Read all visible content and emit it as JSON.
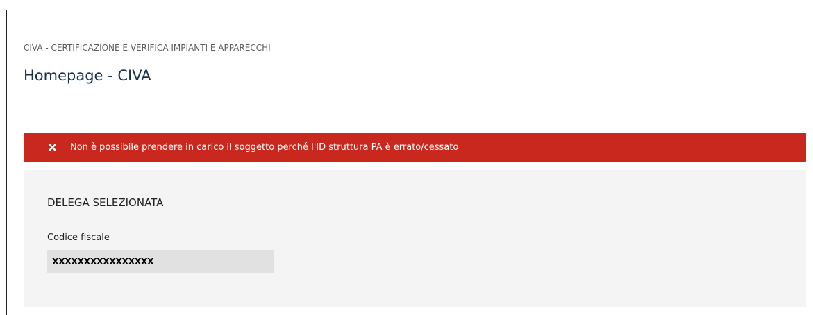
{
  "breadcrumb": "CIVA - CERTIFICAZIONE E VERIFICA IMPIANTI E APPARECCHI",
  "page_title": "Homepage - CIVA",
  "alert": {
    "icon": "close-icon",
    "message": "Non è possibile prendere in carico il soggetto perché l'ID struttura PA è errato/cessato",
    "color": "#c8281e"
  },
  "panel": {
    "title": "DELEGA SELEZIONATA",
    "field_label": "Codice fiscale",
    "field_value": "XXXXXXXXXXXXXXXX"
  }
}
